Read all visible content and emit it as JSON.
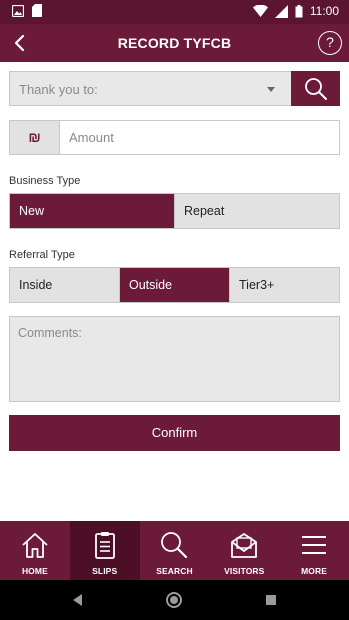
{
  "status_bar": {
    "time": "11:00"
  },
  "header": {
    "title": "RECORD TYFCB",
    "help_label": "?"
  },
  "thank_you": {
    "placeholder": "Thank you to:"
  },
  "amount": {
    "currency_symbol": "₪",
    "placeholder": "Amount"
  },
  "business_type": {
    "label": "Business Type",
    "options": [
      "New",
      "Repeat"
    ],
    "selected": "New"
  },
  "referral_type": {
    "label": "Referral Type",
    "options": [
      "Inside",
      "Outside",
      "Tier3+"
    ],
    "selected": "Outside"
  },
  "comments": {
    "placeholder": "Comments:"
  },
  "confirm": {
    "label": "Confirm"
  },
  "tabs": [
    {
      "label": "HOME",
      "icon": "home-icon"
    },
    {
      "label": "SLIPS",
      "icon": "clipboard-icon",
      "active": true
    },
    {
      "label": "SEARCH",
      "icon": "search-icon"
    },
    {
      "label": "VISITORS",
      "icon": "envelope-icon"
    },
    {
      "label": "MORE",
      "icon": "menu-icon"
    }
  ],
  "colors": {
    "primary": "#6b1a38",
    "status_bar": "#5c1530",
    "active_tab": "#4d0f26",
    "field_bg": "#e8e8e8"
  }
}
